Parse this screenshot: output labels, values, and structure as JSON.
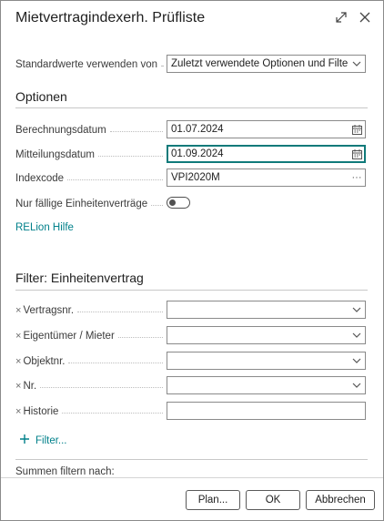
{
  "dialog": {
    "title": "Mietvertragindexerh. Prüfliste",
    "icons": {
      "expand": "expand-icon",
      "close": "close-icon"
    }
  },
  "defaults": {
    "label": "Standardwerte verwenden von",
    "value": "Zuletzt verwendete Optionen und Filter"
  },
  "options": {
    "heading": "Optionen",
    "berechnungsdatum": {
      "label": "Berechnungsdatum",
      "value": "01.07.2024"
    },
    "mitteilungsdatum": {
      "label": "Mitteilungsdatum",
      "value": "01.09.2024"
    },
    "indexcode": {
      "label": "Indexcode",
      "value": "VPI2020M",
      "assist": "···"
    },
    "nur_faellige": {
      "label": "Nur fällige Einheitenverträge",
      "value": false
    },
    "help_link": "RELion Hilfe"
  },
  "filter": {
    "heading": "Filter: Einheitenvertrag",
    "remove_symbol": "×",
    "fields": [
      {
        "label": "Vertragsnr.",
        "value": ""
      },
      {
        "label": "Eigentümer / Mieter",
        "value": ""
      },
      {
        "label": "Objektnr.",
        "value": ""
      },
      {
        "label": "Nr.",
        "value": ""
      },
      {
        "label": "Historie",
        "value": ""
      }
    ],
    "add_filter": "Filter..."
  },
  "summen": {
    "label": "Summen filtern nach:"
  },
  "footer": {
    "plan": "Plan...",
    "ok": "OK",
    "cancel": "Abbrechen"
  },
  "colors": {
    "accent": "#00808a",
    "active_border": "#0f7a7a",
    "border": "#8a8a8a"
  }
}
